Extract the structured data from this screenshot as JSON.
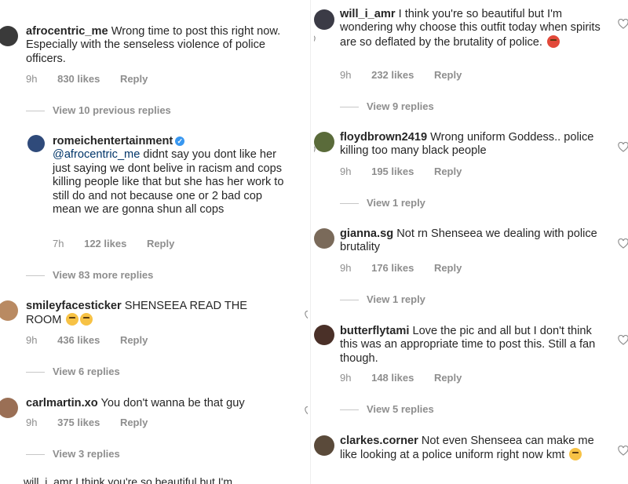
{
  "left": {
    "comment1": {
      "username": "afrocentric_me",
      "text": "Wrong time to post this right now. Especially with the senseless violence of police officers.",
      "time": "9h",
      "likes": "830 likes",
      "reply": "Reply",
      "view_replies": "View 10 previous replies"
    },
    "reply1": {
      "username": "romeichentertainment",
      "mention": "@afrocentric_me",
      "text": "didnt say you dont like her just saying we dont belive in racism and cops killing people like that but she has her work to still do and not because one or 2 bad cop mean we are gonna shun all cops",
      "time": "7h",
      "likes": "122 likes",
      "reply": "Reply",
      "view_replies": "View 83 more replies"
    },
    "comment2": {
      "username": "smileyfacesticker",
      "text": "SHENSEEA READ THE ROOM",
      "emojis": [
        "crying-laughing-emoji",
        "crying-laughing-emoji"
      ],
      "time": "9h",
      "likes": "436 likes",
      "reply": "Reply",
      "view_replies": "View 6 replies"
    },
    "comment3": {
      "username": "carlmartin.xo",
      "text": "You don't wanna be that guy",
      "time": "9h",
      "likes": "375 likes",
      "reply": "Reply",
      "view_replies": "View 3 replies"
    },
    "cut_off": "will_i_amr I think you're so beautiful but I'm"
  },
  "right": {
    "comment1": {
      "username": "will_i_amr",
      "text": "I think you're so beautiful but I'm wondering why choose this outfit today when spirits are so deflated by the brutality of police.",
      "emoji": "angry-face-emoji",
      "time": "9h",
      "likes": "232 likes",
      "reply": "Reply",
      "view_replies": "View 9 replies"
    },
    "comment2": {
      "username": "floydbrown2419",
      "text": "Wrong uniform Goddess.. police killing too many black people",
      "time": "9h",
      "likes": "195 likes",
      "reply": "Reply",
      "view_replies": "View 1 reply"
    },
    "comment3": {
      "username": "gianna.sg",
      "text": "Not rn Shenseea we dealing with police brutality",
      "time": "9h",
      "likes": "176 likes",
      "reply": "Reply",
      "view_replies": "View 1 reply"
    },
    "comment4": {
      "username": "butterflytami",
      "text": "Love the pic and all but I don't think this was an appropriate time to post this. Still a fan though.",
      "time": "9h",
      "likes": "148 likes",
      "reply": "Reply",
      "view_replies": "View 5 replies"
    },
    "comment5": {
      "username": "clarkes.corner",
      "text": "Not even Shenseea can make me like looking at a police uniform right now kmt",
      "emoji": "unamused-face-emoji"
    }
  },
  "colors": {
    "text": "#262626",
    "meta": "#8e8e8e",
    "verified": "#3897f0",
    "mention": "#003569"
  }
}
